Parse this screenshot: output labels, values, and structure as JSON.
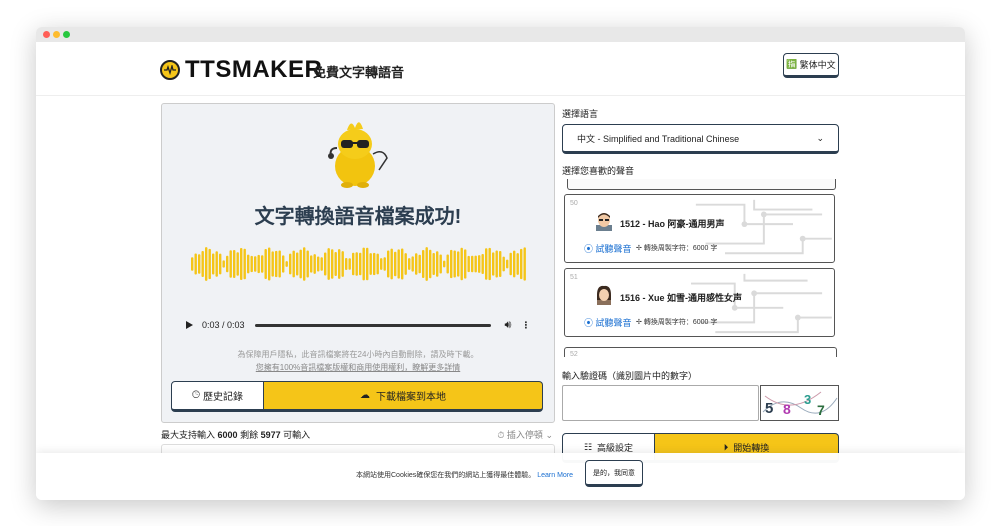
{
  "header": {
    "logo_text": "TTSMAKER",
    "tagline": "免費文字轉語音",
    "lang_button": "繁体中文"
  },
  "result": {
    "success_title": "文字轉換語音檔案成功!",
    "time_display": "0:03 / 0:03",
    "notice_line1": "為保障用戶隱私，此音訊檔案將在24小時內自動刪除，請及時下載。",
    "notice_line2": "您擁有100%音訊檔案版權和商用使用權利，瞭解更多詳情",
    "history_button": "歷史記錄",
    "download_button": "下載檔案到本地"
  },
  "input": {
    "max_prefix": "最大支持輸入",
    "max_value": "6000",
    "remaining_prefix": "剩餘",
    "remaining_value": "5977",
    "remaining_suffix": "可輸入",
    "insert_pause": "插入停頓"
  },
  "language": {
    "label": "選擇語言",
    "selected": "中文 - Simplified and Traditional Chinese"
  },
  "voices": {
    "label": "選擇您喜歡的聲音",
    "items": [
      {
        "num": "50",
        "name": "1512 - Hao 阿豪-通用男声",
        "try": "試聽聲音",
        "cap": "轉換周製字符：6000 字"
      },
      {
        "num": "51",
        "name": "1516 - Xue 如雪-通用感性女声",
        "try": "試聽聲音",
        "cap": "轉換周製字符：6000 字"
      },
      {
        "num": "52"
      }
    ]
  },
  "captcha": {
    "label": "輸入驗證碼（識別圖片中的數字）",
    "image_digits": "5 8 3 7"
  },
  "actions": {
    "advanced": "高級設定",
    "start": "開始轉換"
  },
  "cookie": {
    "text": "本網站使用Cookies確保您在我們的網站上獲得最佳體驗。",
    "learn_more": "Learn More",
    "agree": "是的，我同意"
  },
  "colors": {
    "accent": "#f5c518",
    "dark": "#2c3e50",
    "link": "#1a6fd1"
  }
}
